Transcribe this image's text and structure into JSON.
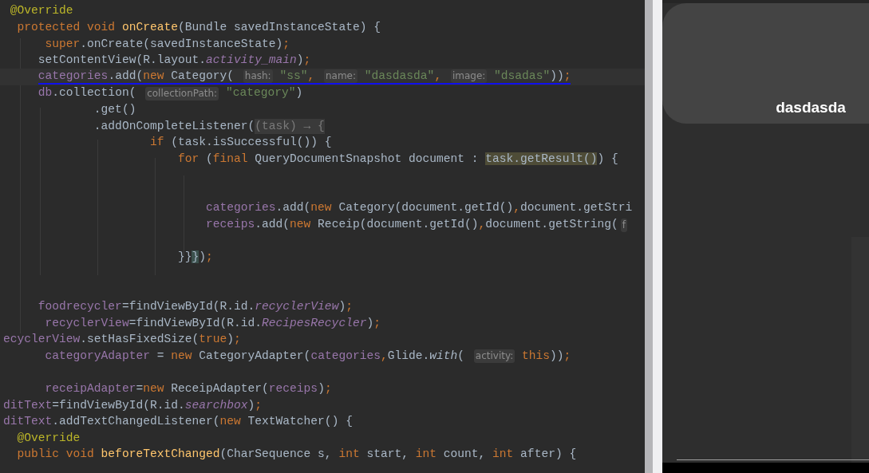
{
  "editor": {
    "lines": [
      {
        "kind": "code",
        "segments": [
          {
            "kind": "annotation",
            "text": " @Override"
          }
        ]
      },
      {
        "kind": "code",
        "segments": [
          {
            "kind": "keyword",
            "text": "  protected void "
          },
          {
            "kind": "method_decl",
            "text": "onCreate"
          },
          {
            "kind": "plain",
            "text": "(Bundle savedInstanceState) {"
          }
        ]
      },
      {
        "kind": "code",
        "segments": [
          {
            "kind": "keyword",
            "text": "      super"
          },
          {
            "kind": "plain",
            "text": ".onCreate(savedInstanceState)"
          },
          {
            "kind": "keyword",
            "text": ";"
          }
        ]
      },
      {
        "kind": "code",
        "segments": [
          {
            "kind": "plain",
            "text": "     setContentView(R.layout."
          },
          {
            "kind": "static",
            "text": "activity_main"
          },
          {
            "kind": "plain",
            "text": ")"
          },
          {
            "kind": "keyword",
            "text": ";"
          }
        ]
      },
      {
        "kind": "code",
        "current": true,
        "underlined": true,
        "segments": [
          {
            "kind": "field",
            "text": "     categories"
          },
          {
            "kind": "plain",
            "text": ".add("
          },
          {
            "kind": "keyword",
            "text": "new"
          },
          {
            "kind": "plain",
            "text": " Category( "
          },
          {
            "kind": "hint",
            "text": "hash:"
          },
          {
            "kind": "string",
            "text": " \"ss\""
          },
          {
            "kind": "keyword",
            "text": ", "
          },
          {
            "kind": "hint",
            "text": "name:"
          },
          {
            "kind": "string",
            "text": " \"dasdasda\""
          },
          {
            "kind": "keyword",
            "text": ", "
          },
          {
            "kind": "hint",
            "text": "image:"
          },
          {
            "kind": "string",
            "text": " \"dsadas\""
          },
          {
            "kind": "plain",
            "text": "))"
          },
          {
            "kind": "keyword",
            "text": ";"
          }
        ]
      },
      {
        "kind": "code",
        "segments": [
          {
            "kind": "field",
            "text": "     db"
          },
          {
            "kind": "plain",
            "text": ".collection( "
          },
          {
            "kind": "hint",
            "text": "collectionPath:"
          },
          {
            "kind": "string",
            "text": " \"category\""
          },
          {
            "kind": "plain",
            "text": ")"
          }
        ]
      },
      {
        "kind": "code",
        "segments": [
          {
            "kind": "plain",
            "text": "             .get()"
          }
        ]
      },
      {
        "kind": "code",
        "segments": [
          {
            "kind": "plain",
            "text": "             .addOnCompleteListener("
          },
          {
            "kind": "folded",
            "text": "(task) → {"
          }
        ]
      },
      {
        "kind": "code",
        "segments": [
          {
            "kind": "keyword",
            "text": "                     if"
          },
          {
            "kind": "plain",
            "text": " (task.isSuccessful()) {"
          }
        ]
      },
      {
        "kind": "code",
        "segments": [
          {
            "kind": "keyword",
            "text": "                         for"
          },
          {
            "kind": "plain",
            "text": " ("
          },
          {
            "kind": "keyword",
            "text": "final"
          },
          {
            "kind": "plain",
            "text": " QueryDocumentSnapshot document : "
          },
          {
            "kind": "match",
            "text": "task.getResult()"
          },
          {
            "kind": "plain",
            "text": ") {"
          }
        ]
      },
      {
        "kind": "blank"
      },
      {
        "kind": "blank"
      },
      {
        "kind": "code",
        "segments": [
          {
            "kind": "field",
            "text": "                             categories"
          },
          {
            "kind": "plain",
            "text": ".add("
          },
          {
            "kind": "keyword",
            "text": "new"
          },
          {
            "kind": "plain",
            "text": " Category(document.getId()"
          },
          {
            "kind": "keyword",
            "text": ","
          },
          {
            "kind": "plain",
            "text": "document.getStri"
          }
        ]
      },
      {
        "kind": "code",
        "segments": [
          {
            "kind": "field",
            "text": "                             receips"
          },
          {
            "kind": "plain",
            "text": ".add("
          },
          {
            "kind": "keyword",
            "text": "new"
          },
          {
            "kind": "plain",
            "text": " Receip(document.getId()"
          },
          {
            "kind": "keyword",
            "text": ","
          },
          {
            "kind": "plain",
            "text": "document.getString("
          },
          {
            "kind": "hint",
            "text": "f"
          }
        ]
      },
      {
        "kind": "blank"
      },
      {
        "kind": "code",
        "segments": [
          {
            "kind": "plain",
            "text": "                         }}"
          },
          {
            "kind": "brace_match",
            "text": "}"
          },
          {
            "kind": "plain",
            "text": ")"
          },
          {
            "kind": "keyword",
            "text": ";"
          }
        ]
      },
      {
        "kind": "blank"
      },
      {
        "kind": "blank"
      },
      {
        "kind": "code",
        "segments": [
          {
            "kind": "field",
            "text": "     foodrecycler"
          },
          {
            "kind": "plain",
            "text": "=findViewById(R.id."
          },
          {
            "kind": "static",
            "text": "recyclerView"
          },
          {
            "kind": "plain",
            "text": ")"
          },
          {
            "kind": "keyword",
            "text": ";"
          }
        ]
      },
      {
        "kind": "code",
        "segments": [
          {
            "kind": "field",
            "text": "      recyclerView"
          },
          {
            "kind": "plain",
            "text": "=findViewById(R.id."
          },
          {
            "kind": "static",
            "text": "RecipesRecycler"
          },
          {
            "kind": "plain",
            "text": ")"
          },
          {
            "kind": "keyword",
            "text": ";"
          }
        ]
      },
      {
        "kind": "code",
        "segments": [
          {
            "kind": "field",
            "text": "ecyclerView"
          },
          {
            "kind": "plain",
            "text": ".setHasFixedSize("
          },
          {
            "kind": "keyword",
            "text": "true"
          },
          {
            "kind": "plain",
            "text": ")"
          },
          {
            "kind": "keyword",
            "text": ";"
          }
        ]
      },
      {
        "kind": "code",
        "segments": [
          {
            "kind": "field",
            "text": "      categoryAdapter"
          },
          {
            "kind": "plain",
            "text": " = "
          },
          {
            "kind": "keyword",
            "text": "new"
          },
          {
            "kind": "plain",
            "text": " CategoryAdapter("
          },
          {
            "kind": "field",
            "text": "categories"
          },
          {
            "kind": "keyword",
            "text": ","
          },
          {
            "kind": "plain",
            "text": "Glide."
          },
          {
            "kind": "static_method",
            "text": "with"
          },
          {
            "kind": "plain",
            "text": "( "
          },
          {
            "kind": "hint",
            "text": "activity:"
          },
          {
            "kind": "keyword",
            "text": " this"
          },
          {
            "kind": "plain",
            "text": "))"
          },
          {
            "kind": "keyword",
            "text": ";"
          }
        ]
      },
      {
        "kind": "blank"
      },
      {
        "kind": "code",
        "segments": [
          {
            "kind": "field",
            "text": "      receipAdapter"
          },
          {
            "kind": "plain",
            "text": "="
          },
          {
            "kind": "keyword",
            "text": "new"
          },
          {
            "kind": "plain",
            "text": " ReceipAdapter("
          },
          {
            "kind": "field",
            "text": "receips"
          },
          {
            "kind": "plain",
            "text": ")"
          },
          {
            "kind": "keyword",
            "text": ";"
          }
        ]
      },
      {
        "kind": "code",
        "segments": [
          {
            "kind": "field",
            "text": "ditText"
          },
          {
            "kind": "plain",
            "text": "=findViewById(R.id."
          },
          {
            "kind": "static",
            "text": "searchbox"
          },
          {
            "kind": "plain",
            "text": ")"
          },
          {
            "kind": "keyword",
            "text": ";"
          }
        ]
      },
      {
        "kind": "code",
        "segments": [
          {
            "kind": "field",
            "text": "ditText"
          },
          {
            "kind": "plain",
            "text": ".addTextChangedListener("
          },
          {
            "kind": "keyword",
            "text": "new"
          },
          {
            "kind": "plain",
            "text": " TextWatcher() {"
          }
        ]
      },
      {
        "kind": "code",
        "segments": [
          {
            "kind": "annotation",
            "text": "  @Override"
          }
        ]
      },
      {
        "kind": "code",
        "segments": [
          {
            "kind": "keyword",
            "text": "  public void "
          },
          {
            "kind": "method_decl",
            "text": "beforeTextChanged"
          },
          {
            "kind": "plain",
            "text": "(CharSequence s, "
          },
          {
            "kind": "keyword",
            "text": "int"
          },
          {
            "kind": "plain",
            "text": " start, "
          },
          {
            "kind": "keyword",
            "text": "int"
          },
          {
            "kind": "plain",
            "text": " count, "
          },
          {
            "kind": "keyword",
            "text": "int"
          },
          {
            "kind": "plain",
            "text": " after) {"
          }
        ]
      }
    ]
  },
  "emulator": {
    "card": {
      "title": "dasdasda"
    }
  }
}
